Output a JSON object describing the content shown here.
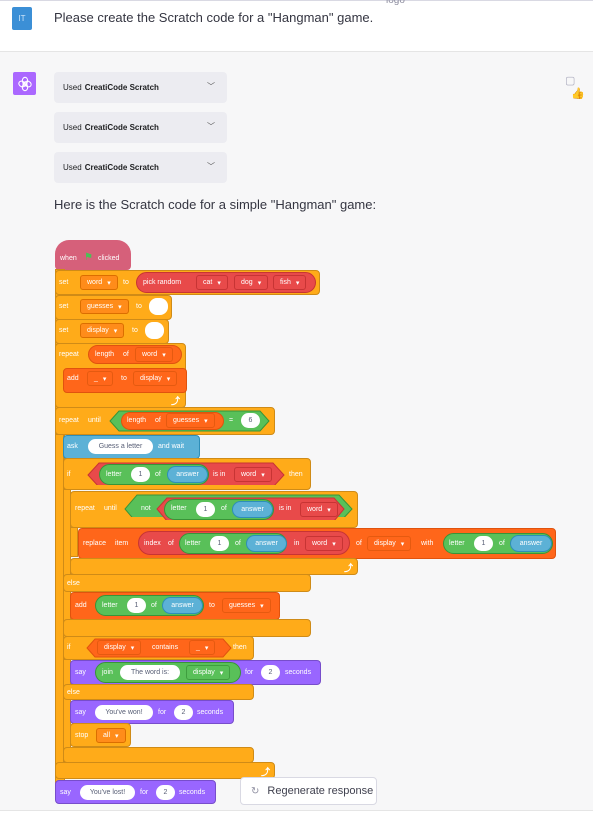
{
  "user": {
    "avatar_initials": "IT",
    "message": "Please create the Scratch code for a \"Hangman\" game.",
    "logo_alt": "logo"
  },
  "assistant": {
    "tools": [
      {
        "prefix": "Used",
        "name": "CreatiCode Scratch"
      },
      {
        "prefix": "Used",
        "name": "CreatiCode Scratch"
      },
      {
        "prefix": "Used",
        "name": "CreatiCode Scratch"
      }
    ],
    "intro": "Here is the Scratch code for a simple \"Hangman\" game:"
  },
  "scratch": {
    "when": "when",
    "clicked": "clicked",
    "set": "set",
    "to": "to",
    "word": "word",
    "guesses": "guesses",
    "display": "display",
    "pick_random": "pick random",
    "cat": "cat",
    "dog": "dog",
    "fish": "fish",
    "repeat": "repeat",
    "repeat_until": "repeat",
    "until": "until",
    "length_of": "length",
    "of": "of",
    "add": "add",
    "underscore": "_",
    "equals": "=",
    "six": "6",
    "ask": "ask",
    "ask_text": "Guess a letter",
    "and_wait": "and wait",
    "if": "if",
    "then": "then",
    "else": "else",
    "letter": "letter",
    "one": "1",
    "answer": "answer",
    "is_in": "is in",
    "not": "not",
    "replace_item": "replace",
    "item": "item",
    "index_of": "index",
    "in": "in",
    "with": "with",
    "contains": "contains",
    "say": "say",
    "join": "join",
    "the_word_is": "The word is:",
    "for": "for",
    "two": "2",
    "seconds": "seconds",
    "you_won": "You've won!",
    "stop": "stop",
    "all": "all",
    "you_lost": "You've lost!"
  },
  "actions": {
    "regenerate": "Regenerate response"
  },
  "colors": {
    "events": "#d6607a",
    "variables": "#ffab19",
    "lists": "#ff661a",
    "control": "#ffab19",
    "sensing": "#5cb1d6",
    "looks": "#9966ff",
    "operators": "#59c059",
    "operators_red": "#e84a4a",
    "bot_avatar": "#ab68ff",
    "user_avatar": "#3b8fd6"
  }
}
